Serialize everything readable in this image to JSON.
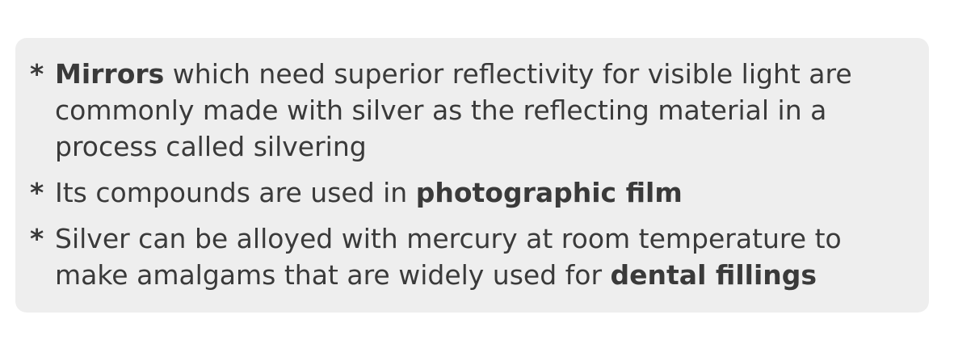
{
  "bullets": [
    {
      "marker": "*",
      "parts": [
        {
          "text": "Mirrors",
          "bold": true
        },
        {
          "text": " which need superior reflectivity for visible light are commonly made with silver as the reflecting material in a process called silvering",
          "bold": false
        }
      ]
    },
    {
      "marker": "*",
      "parts": [
        {
          "text": "Its compounds are used in ",
          "bold": false
        },
        {
          "text": "photographic film",
          "bold": true
        }
      ]
    },
    {
      "marker": "*",
      "parts": [
        {
          "text": "Silver can be alloyed with mercury at room temperature to make amalgams that are widely used for ",
          "bold": false
        },
        {
          "text": "dental fillings",
          "bold": true
        }
      ]
    }
  ]
}
